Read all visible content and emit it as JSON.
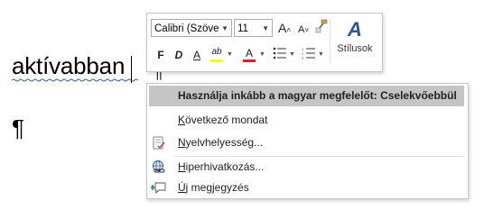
{
  "document": {
    "word_prefix": "aktívabba",
    "word_suffix": "n",
    "pilcrow_mark": "¶"
  },
  "mini_toolbar": {
    "font_name": "Calibri (Szöve",
    "font_size": "11",
    "grow_font_icon": "A",
    "shrink_font_icon": "A",
    "bold_label": "F",
    "italic_label": "D",
    "underline_label": "A",
    "highlight_label": "ab",
    "font_color_label": "A",
    "styles_label": "Stílusok",
    "styles_icon": "A",
    "highlight_color": "#ffff00",
    "font_color": "#e02020"
  },
  "context_menu": {
    "suggestion": "Használja inkább a magyar megfelelőt: Cselekvőebbül",
    "items": [
      {
        "label": "Következő mondat",
        "accel_char": "K",
        "rest": "övetkező mondat"
      },
      {
        "label": "Nyelvhelyesség...",
        "accel_char": "N",
        "rest": "yelvhelyesség..."
      },
      {
        "label": "Hiperhivatkozás...",
        "accel_char": "H",
        "rest": "iperhivatkozás..."
      },
      {
        "label": "Új megjegyzés",
        "accel_char": "Ú",
        "rest": "j megjegyzés"
      }
    ]
  }
}
